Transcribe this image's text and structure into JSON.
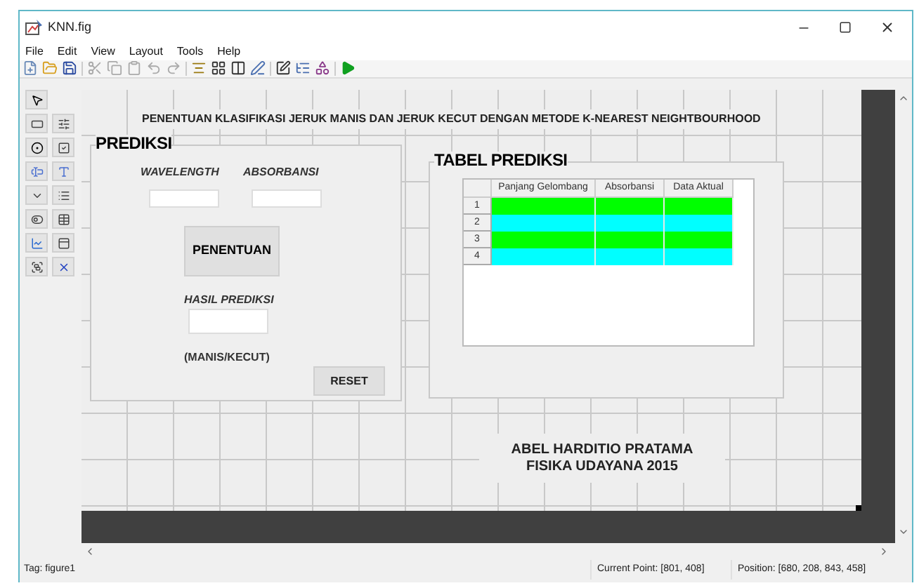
{
  "window": {
    "title": "KNN.fig"
  },
  "menu": [
    "File",
    "Edit",
    "View",
    "Layout",
    "Tools",
    "Help"
  ],
  "canvas": {
    "title": "PENENTUAN KLASIFIKASI  JERUK MANIS DAN JERUK KECUT DENGAN METODE K-NEAREST NEIGHTBOURHOOD"
  },
  "prediksi_panel": {
    "title": "PREDIKSI",
    "wavelength_label": "WAVELENGTH",
    "absorbansi_label": "ABSORBANSI",
    "penentuan_button": "PENENTUAN",
    "hasil_label": "HASIL PREDIKSI",
    "manis_kecut_label": "(MANIS/KECUT)",
    "reset_button": "RESET"
  },
  "tabel_panel": {
    "title": "TABEL PREDIKSI",
    "table": {
      "columns": [
        "Panjang Gelombang",
        "Absorbansi",
        "Data Aktual"
      ],
      "rows": [
        {
          "label": "1",
          "color": "#00ff00"
        },
        {
          "label": "2",
          "color": "#00ffff"
        },
        {
          "label": "3",
          "color": "#00ff00"
        },
        {
          "label": "4",
          "color": "#00ffff"
        }
      ]
    }
  },
  "author": {
    "name": "ABEL HARDITIO PRATAMA",
    "affiliation": "FISIKA UDAYANA 2015"
  },
  "status_bar": {
    "tag": "Tag: figure1",
    "current_point": "Current Point:  [801, 408]",
    "position": "Position: [680, 208, 843, 458]"
  }
}
